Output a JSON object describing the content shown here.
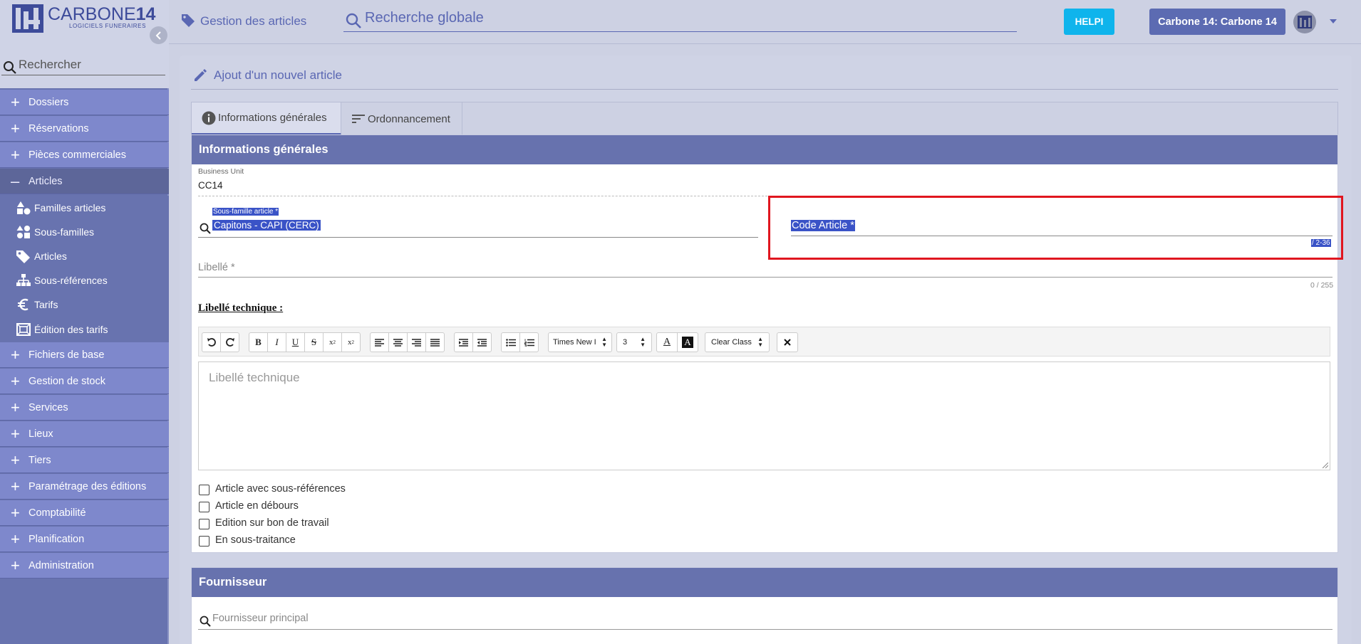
{
  "brand": {
    "name_light": "CARBONE",
    "name_bold": "14",
    "subtitle": "LOGICIELS FUNERAIRES"
  },
  "sidebar": {
    "search_placeholder": "Rechercher",
    "items": [
      {
        "label": "Dossiers",
        "icon": "plus-icon"
      },
      {
        "label": "Réservations",
        "icon": "plus-icon"
      },
      {
        "label": "Pièces commerciales",
        "icon": "plus-icon"
      },
      {
        "label": "Articles",
        "icon": "minus-icon",
        "open": true
      },
      {
        "label": "Fichiers de base",
        "icon": "plus-icon"
      },
      {
        "label": "Gestion de stock",
        "icon": "plus-icon"
      },
      {
        "label": "Services",
        "icon": "plus-icon"
      },
      {
        "label": "Lieux",
        "icon": "plus-icon"
      },
      {
        "label": "Tiers",
        "icon": "plus-icon"
      },
      {
        "label": "Paramétrage des éditions",
        "icon": "plus-icon"
      },
      {
        "label": "Comptabilité",
        "icon": "plus-icon"
      },
      {
        "label": "Planification",
        "icon": "plus-icon"
      },
      {
        "label": "Administration",
        "icon": "plus-icon"
      }
    ],
    "sub_items": [
      {
        "label": "Familles articles",
        "icon": "shapes-icon"
      },
      {
        "label": "Sous-familles",
        "icon": "category-icon"
      },
      {
        "label": "Articles",
        "icon": "tag-icon"
      },
      {
        "label": "Sous-références",
        "icon": "hierarchy-icon"
      },
      {
        "label": "Tarifs",
        "icon": "euro-icon"
      },
      {
        "label": "Édition des tarifs",
        "icon": "print-frame-icon"
      }
    ]
  },
  "topbar": {
    "section_title": "Gestion des articles",
    "search_placeholder": "Recherche globale",
    "helpi_label": "HELPI",
    "account_label": "Carbone 14: Carbone 14"
  },
  "page": {
    "title": "Ajout d'un nouvel article",
    "tabs": [
      {
        "label": "Informations générales",
        "icon": "info-icon",
        "active": true
      },
      {
        "label": "Ordonnancement",
        "icon": "sort-icon",
        "active": false
      }
    ]
  },
  "general": {
    "section_title": "Informations générales",
    "business_unit_label": "Business Unit",
    "business_unit_value": "CC14",
    "subfamily_label": "Sous-famille article *",
    "subfamily_value": "Capitons - CAPI (CERC)",
    "code_label": "Code Article *",
    "code_counter": "/ 2-36",
    "libelle_label": "Libellé *",
    "libelle_counter": "0 / 255",
    "libelle_technique_title": "Libellé technique :",
    "editor_placeholder": "Libellé technique",
    "font_select": "Times New I",
    "size_select": "3",
    "class_select": "Clear Class",
    "checkboxes": [
      {
        "label": "Article avec sous-références",
        "checked": false
      },
      {
        "label": "Article en débours",
        "checked": false
      },
      {
        "label": "Edition sur bon de travail",
        "checked": false
      },
      {
        "label": "En sous-traitance",
        "checked": false
      }
    ]
  },
  "supplier": {
    "section_title": "Fournisseur",
    "principal_placeholder": "Fournisseur principal"
  },
  "colors": {
    "accent": "#5a67b3",
    "sidebar": "#6873af",
    "helpi": "#0fb4ec",
    "highlight": "#e0161f"
  }
}
